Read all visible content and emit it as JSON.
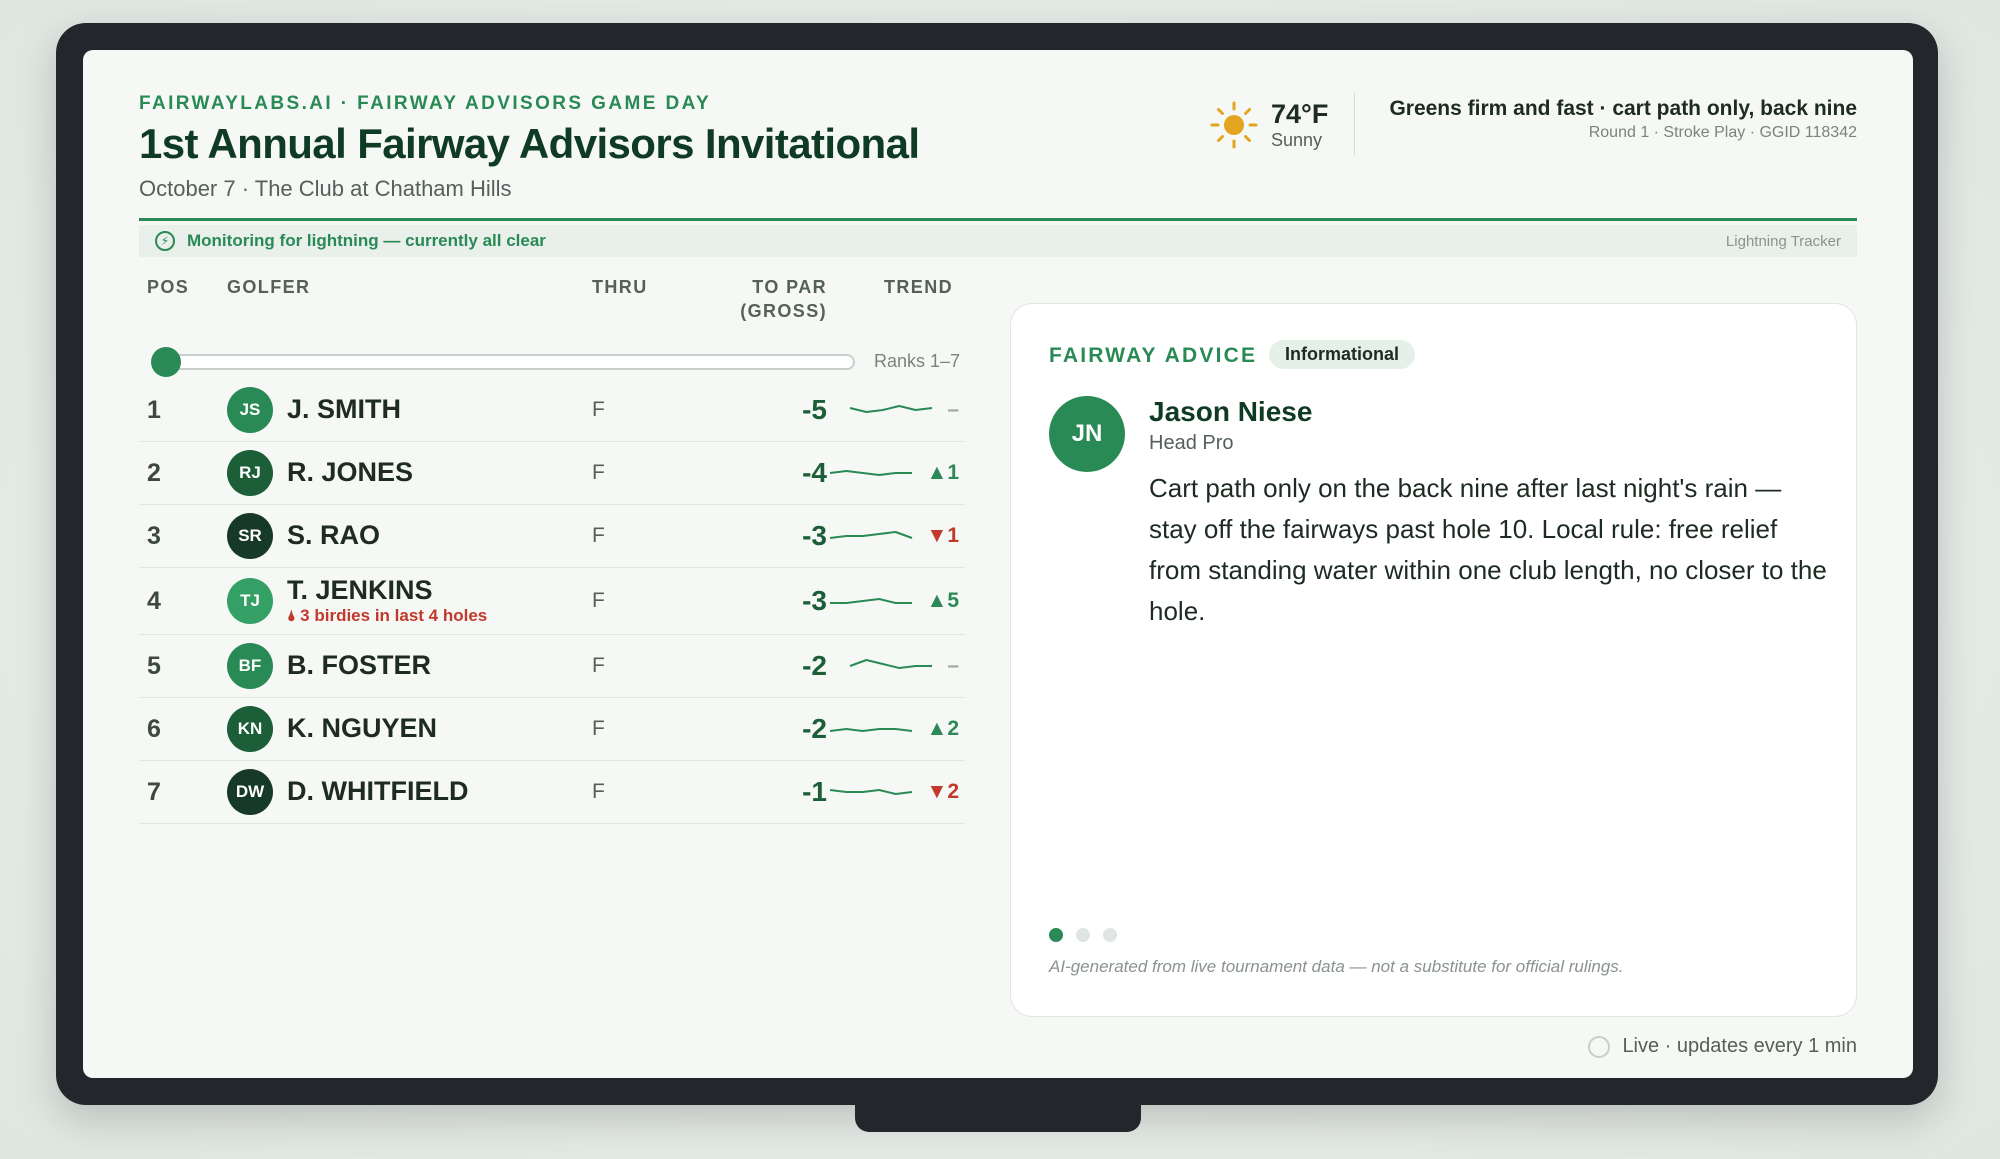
{
  "header": {
    "eyebrow": "FAIRWAYLABS.AI · FAIRWAY ADVISORS GAME DAY",
    "title": "1st Annual Fairway Advisors Invitational",
    "subtitle": "October 7 · The Club at Chatham Hills"
  },
  "weather": {
    "icon": "sun-icon",
    "temp": "74°F",
    "condition": "Sunny"
  },
  "notice": {
    "main": "Greens firm and fast · cart path only, back nine",
    "sub": "Round 1 · Stroke Play · GGID 118342"
  },
  "lightning": {
    "icon": "lightning-icon",
    "status": "Monitoring for lightning — currently all clear",
    "tag": "Lightning Tracker"
  },
  "leaderboard": {
    "headers": {
      "pos": "POS",
      "golfer": "GOLFER",
      "thru": "THRU",
      "to_par": "TO PAR\n(GROSS)",
      "trend": "TREND"
    },
    "ranks_label": "Ranks 1–7",
    "rows": [
      {
        "pos": "1",
        "initials": "JS",
        "name": "J. SMITH",
        "thru": "F",
        "score": "-5",
        "move": "–",
        "dir": "flat",
        "avatar_color": "#2a8a55",
        "spark": [
          10,
          14,
          12,
          8,
          12,
          10
        ]
      },
      {
        "pos": "2",
        "initials": "RJ",
        "name": "R. JONES",
        "thru": "F",
        "score": "-4",
        "move": "▲1",
        "dir": "up",
        "avatar_color": "#1b5e37",
        "spark": [
          12,
          10,
          12,
          14,
          12,
          12
        ]
      },
      {
        "pos": "3",
        "initials": "SR",
        "name": "S. RAO",
        "thru": "F",
        "score": "-3",
        "move": "▼1",
        "dir": "down",
        "avatar_color": "#163a27",
        "spark": [
          14,
          12,
          12,
          10,
          8,
          14
        ]
      },
      {
        "pos": "4",
        "initials": "TJ",
        "name": "T. JENKINS",
        "hot": "3 birdies in last 4 holes",
        "thru": "F",
        "score": "-3",
        "move": "▲5",
        "dir": "up",
        "avatar_color": "#34a065",
        "spark": [
          14,
          14,
          12,
          10,
          14,
          14
        ]
      },
      {
        "pos": "5",
        "initials": "BF",
        "name": "B. FOSTER",
        "thru": "F",
        "score": "-2",
        "move": "–",
        "dir": "flat",
        "avatar_color": "#2a8a55",
        "spark": [
          12,
          6,
          10,
          14,
          12,
          12
        ]
      },
      {
        "pos": "6",
        "initials": "KN",
        "name": "K. NGUYEN",
        "thru": "F",
        "score": "-2",
        "move": "▲2",
        "dir": "up",
        "avatar_color": "#1b5e37",
        "spark": [
          14,
          12,
          14,
          12,
          12,
          14
        ]
      },
      {
        "pos": "7",
        "initials": "DW",
        "name": "D. WHITFIELD",
        "thru": "F",
        "score": "-1",
        "move": "▼2",
        "dir": "down",
        "avatar_color": "#163a27",
        "spark": [
          10,
          12,
          12,
          10,
          14,
          12
        ]
      }
    ]
  },
  "advice": {
    "label": "FAIRWAY ADVICE",
    "badge": "Informational",
    "initials": "JN",
    "author": "Jason Niese",
    "role": "Head Pro",
    "text": "Cart path only on the back nine after last night's rain — stay off the fairways past hole 10. Local rule: free relief from standing water within one club length, no closer to the hole.",
    "disclaimer": "AI-generated from live tournament data — not a substitute for official rulings.",
    "pages": 3,
    "active_page": 1
  },
  "live": {
    "text": "Live · updates every 1 min"
  },
  "colors": {
    "accent": "#2a8a55",
    "dark_green": "#0f3a24",
    "down": "#c0392b"
  }
}
